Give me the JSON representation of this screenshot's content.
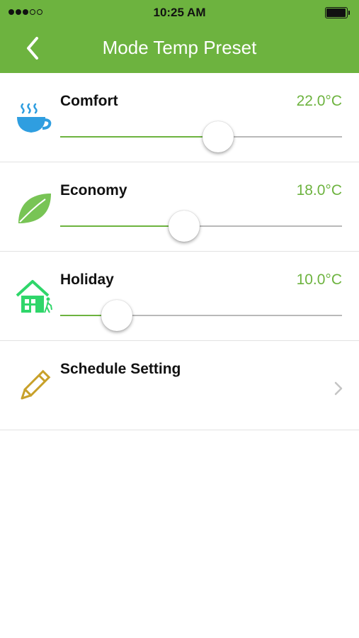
{
  "status_bar": {
    "time": "10:25 AM",
    "signal_bars_filled": 3,
    "signal_bars_total": 5,
    "battery_level": 0.85
  },
  "header": {
    "title": "Mode Temp Preset",
    "back_icon": "chevron-left-icon"
  },
  "presets": [
    {
      "label": "Comfort",
      "value": "22.0°C",
      "icon": "coffee-cup-icon",
      "slider_level": 0.56
    },
    {
      "label": "Economy",
      "value": "18.0°C",
      "icon": "leaf-icon",
      "slider_level": 0.44
    },
    {
      "label": "Holiday",
      "value": "10.0°C",
      "icon": "house-icon",
      "slider_level": 0.2
    }
  ],
  "schedule": {
    "label": "Schedule Setting",
    "icon": "pencil-icon"
  },
  "colors": {
    "brand_green": "#6db33f",
    "cup_blue": "#2f9ee0",
    "leaf_green": "#78c455",
    "house_green": "#2fd66a",
    "pencil_gold": "#c8a12a"
  }
}
